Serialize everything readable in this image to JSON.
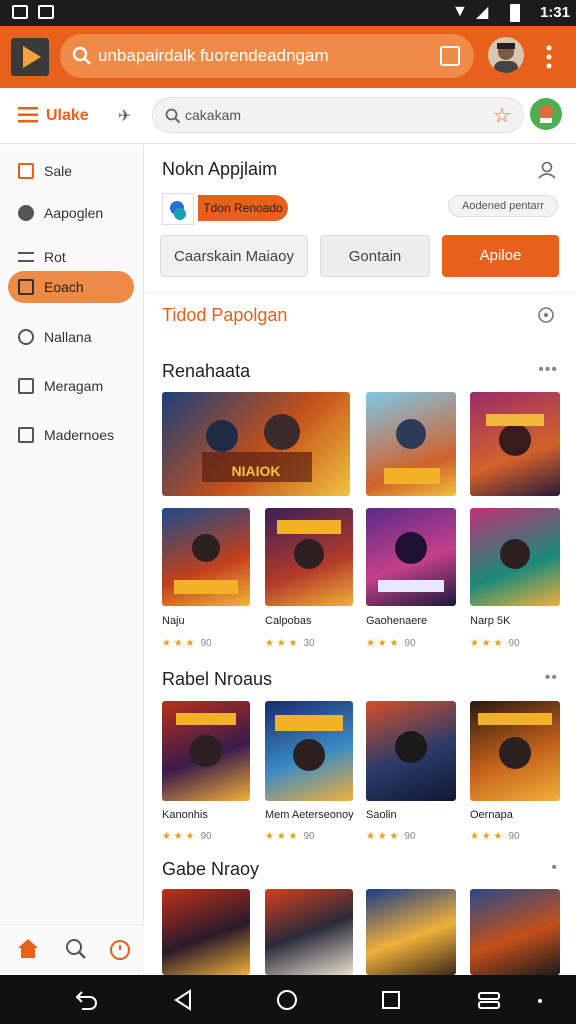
{
  "status": {
    "time": "1:31"
  },
  "appbar": {
    "search_text": "unbapairdalk fuorendeadngam",
    "colors": {
      "primary": "#e8611c",
      "search_bg": "#f08a47"
    }
  },
  "toolbar": {
    "brand": "Ulake",
    "search_text": "cakakam"
  },
  "sidebar": {
    "items": [
      {
        "label": "Sale",
        "icon": "square-icon"
      },
      {
        "label": "Aapoglen",
        "icon": "dial-icon"
      },
      {
        "label": "Rot",
        "icon": "list-icon"
      },
      {
        "label": "Eoach",
        "icon": "folder-icon",
        "active": true
      },
      {
        "label": "Nallana",
        "icon": "circle-icon"
      },
      {
        "label": "Meragam",
        "icon": "edit-icon"
      },
      {
        "label": "Madernoes",
        "icon": "box-icon"
      }
    ]
  },
  "card": {
    "title": "Nokn Appjlaim",
    "tag": "Tdon Renoado",
    "meta_chip": "Aodened pentarr",
    "buttons": [
      "Caarskain Maiaoy",
      "Gontain",
      "Apiloe"
    ]
  },
  "sections": {
    "s1": "Tidod Papolgan",
    "s2": "Renahaata",
    "s3": "Rabel Nroaus",
    "s4": "Gabe Nraoy"
  },
  "games_row2": [
    {
      "title": "Naju",
      "rating": "90"
    },
    {
      "title": "Calpobas",
      "rating": "30"
    },
    {
      "title": "Gaohenaere",
      "rating": "90"
    },
    {
      "title": "Narp 5K",
      "rating": "90"
    }
  ],
  "games_row3": [
    {
      "title": "Kanonhis",
      "rating": "90"
    },
    {
      "title": "Mem Aeterseonoy",
      "rating": "90"
    },
    {
      "title": "Saolin",
      "rating": "90"
    },
    {
      "title": "Oernapa",
      "rating": "90"
    }
  ],
  "stars": "★ ★ ★"
}
